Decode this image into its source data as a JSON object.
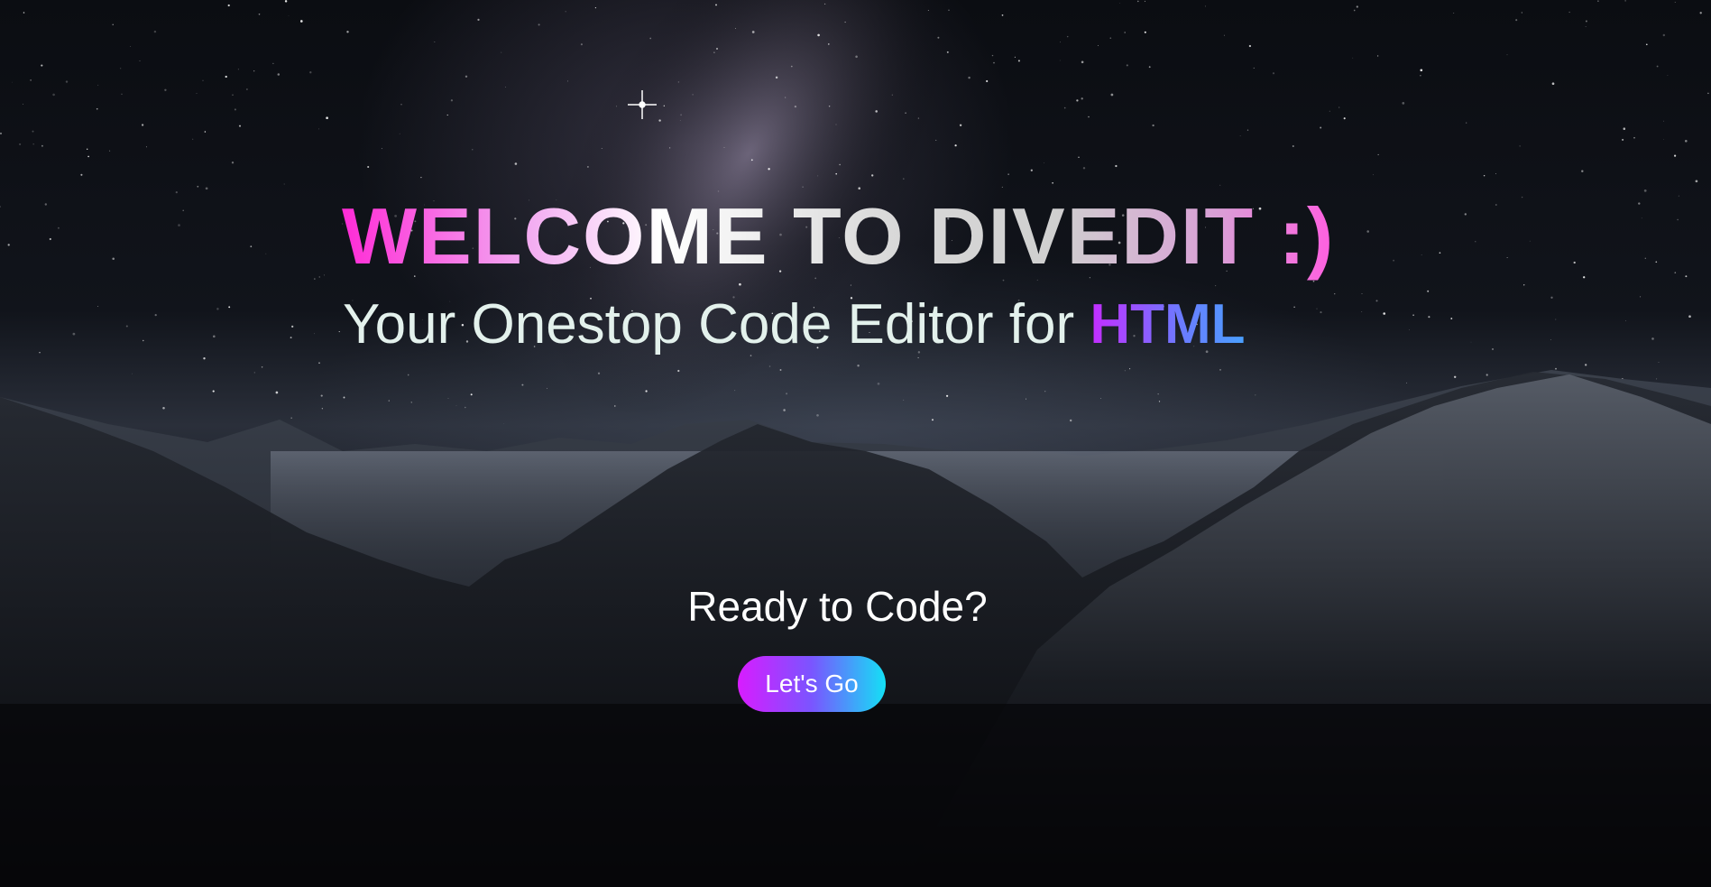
{
  "hero": {
    "title": "WELCOME TO DIVEDIT :)",
    "subtitle_prefix": "Your Onestop Code Editor for ",
    "subtitle_accent": "HTML",
    "cta_prompt": "Ready to Code?",
    "cta_button_label": "Let's Go"
  },
  "colors": {
    "title_gradient_start": "#ff2bd6",
    "accent_gradient_start": "#c52cff",
    "accent_gradient_end": "#4aa0ff",
    "button_gradient_start": "#d81cff",
    "button_gradient_end": "#14e0f5",
    "subtitle_text": "#e3f1ec"
  },
  "background": {
    "icon": "night-mountain-landscape"
  }
}
